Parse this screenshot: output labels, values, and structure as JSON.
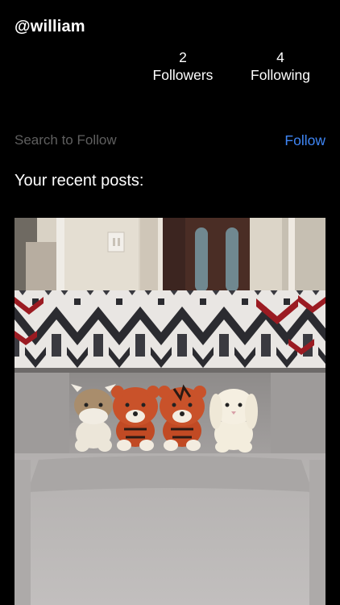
{
  "profile": {
    "username": "@william",
    "followers": {
      "count": "2",
      "label": "Followers"
    },
    "following": {
      "count": "4",
      "label": "Following"
    }
  },
  "search": {
    "placeholder": "Search to Follow",
    "value": "",
    "follow_label": "Follow"
  },
  "posts_section": {
    "title": "Your recent posts:",
    "posts": [
      {
        "image": "photo of four crocheted stuffed animals (horse, two tigers, bunny) on a grey couch under a patterned throw blanket"
      }
    ]
  },
  "colors": {
    "background": "#000000",
    "text": "#ffffff",
    "accent": "#3f86f5",
    "placeholder": "#5f5f5f"
  }
}
